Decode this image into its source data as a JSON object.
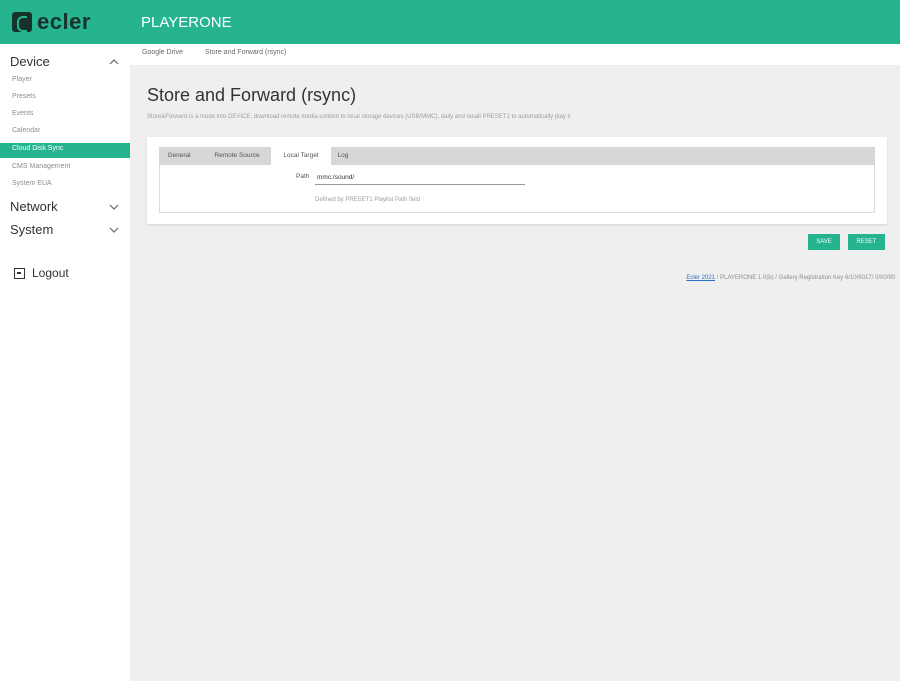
{
  "header": {
    "brand": "ecler",
    "product": "PLAYERONE"
  },
  "sidebar": {
    "sections": [
      {
        "label": "Device",
        "expanded": true
      },
      {
        "label": "Network",
        "expanded": false
      },
      {
        "label": "System",
        "expanded": false
      }
    ],
    "device_items": [
      {
        "label": "Player",
        "active": false
      },
      {
        "label": "Presets",
        "active": false
      },
      {
        "label": "Events",
        "active": false
      },
      {
        "label": "Calendar",
        "active": false
      },
      {
        "label": "Cloud Disk Sync",
        "active": true
      },
      {
        "label": "CMS Management",
        "active": false
      },
      {
        "label": "System EUA",
        "active": false
      }
    ],
    "logout_label": "Logout"
  },
  "breadcrumbs": [
    "Google Drive",
    "Store and Forward (rsync)"
  ],
  "page": {
    "title": "Store and Forward (rsync)",
    "description": "Store&Forward is a mode into DEVICE, download remote media content to local storage devices (USB/MMC), daily and recall PRESET1 to automatically play it"
  },
  "tabs": [
    {
      "label": "General",
      "active": false
    },
    {
      "label": "Remote Source",
      "active": false
    },
    {
      "label": "Local Target",
      "active": true
    },
    {
      "label": "Log",
      "active": false
    }
  ],
  "local_target": {
    "path_label": "Path",
    "path_value": "mmc:/sound/",
    "path_help": "Defined by PRESET1 Playlist Path field"
  },
  "buttons": {
    "save": "SAVE",
    "reset": "RESET"
  },
  "footer": {
    "link": "Ecler 2021",
    "info": " / PLAYERONE 1.0(b) / Gallery Registration Key 6/10/6017/ 0/00/90"
  },
  "colors": {
    "accent": "#25b48e",
    "brand_dark": "#16322a",
    "content_bg": "#efefef"
  }
}
